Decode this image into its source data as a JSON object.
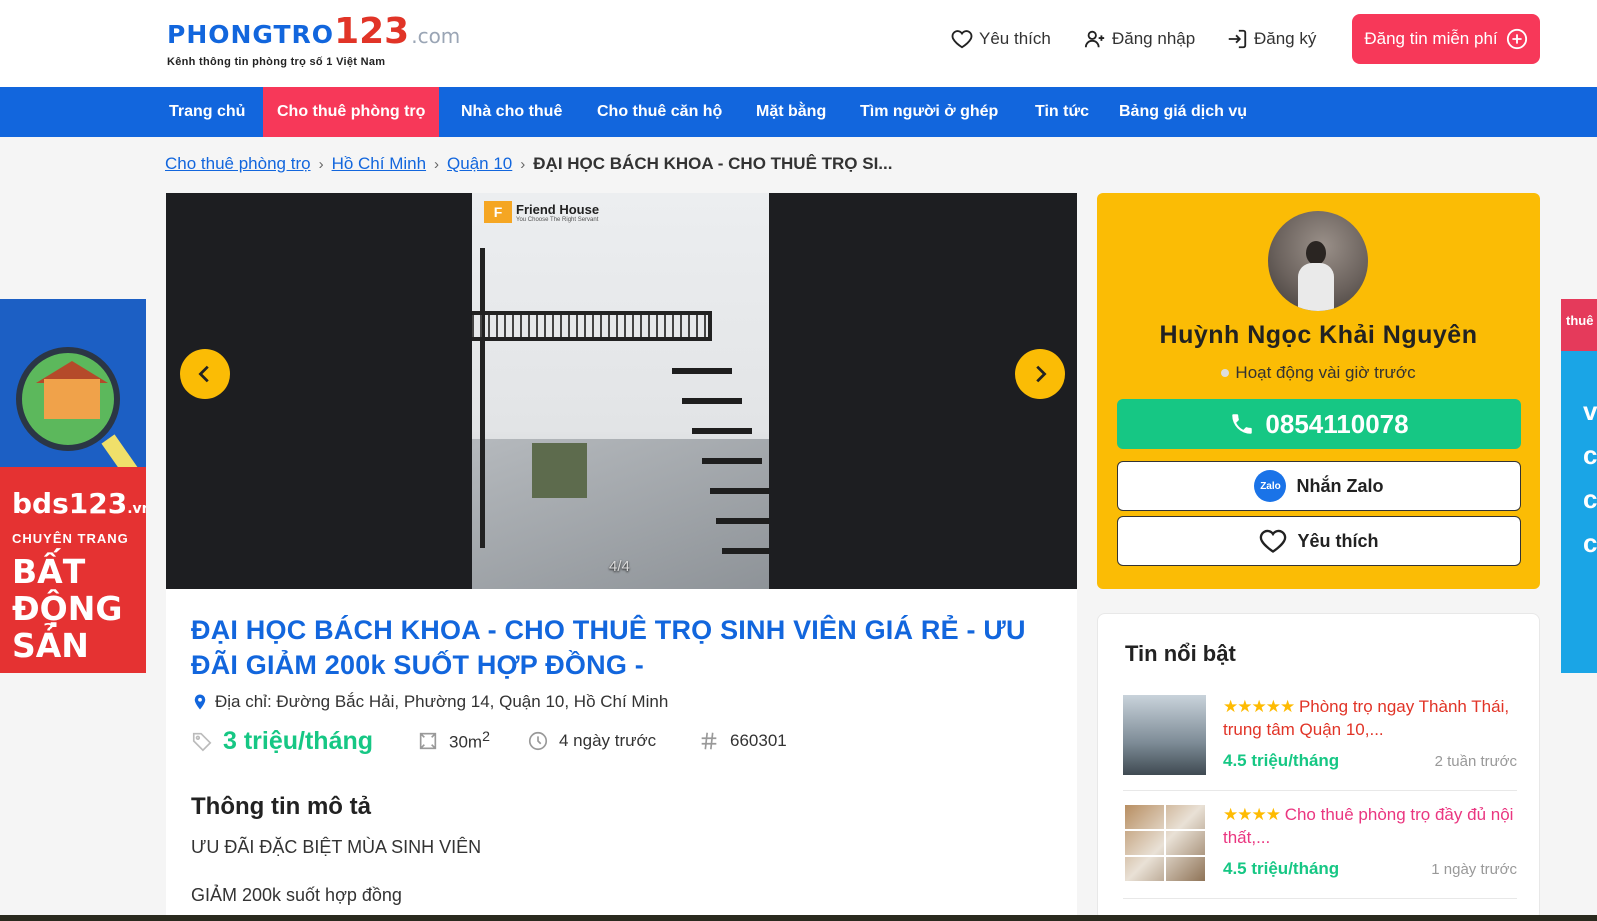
{
  "header": {
    "logo_main": "PHONGTRO",
    "logo_num": "123",
    "logo_domain": ".com",
    "logo_tagline": "Kênh thông tin phòng trọ số 1 Việt Nam",
    "favorite": "Yêu thích",
    "login": "Đăng nhập",
    "register": "Đăng ký",
    "post_free": "Đăng tin miễn phí"
  },
  "nav": [
    "Trang chủ",
    "Cho thuê phòng trọ",
    "Nhà cho thuê",
    "Cho thuê căn hộ",
    "Mặt bằng",
    "Tìm người ở ghép",
    "Tin tức",
    "Bảng giá dịch vụ"
  ],
  "breadcrumb": {
    "items": [
      "Cho thuê phòng trọ",
      "Hồ Chí Minh",
      "Quận 10"
    ],
    "current": "ĐẠI HỌC BÁCH KHOA - CHO THUÊ TRỌ SI..."
  },
  "ads": {
    "left_brand": "bds123",
    "left_brand_domain": ".vn",
    "left_sub": "CHUYÊN TRANG",
    "left_big": [
      "BẤT",
      "ĐỘNG",
      "SẢN"
    ],
    "right_top": "thuê",
    "right_chars": [
      "v",
      "c",
      "c",
      "c"
    ]
  },
  "gallery": {
    "counter": "4/4",
    "watermark": "Friend House",
    "watermark_sub": "You Choose The Right Servant",
    "watermark_letter": "F"
  },
  "post": {
    "title": "ĐẠI HỌC BÁCH KHOA - CHO THUÊ TRỌ SINH VIÊN GIÁ RẺ - ƯU ĐÃI GIẢM 200k SUỐT HỢP ĐỒNG -",
    "address": "Địa chỉ: Đường Bắc Hải, Phường 14, Quận 10, Hồ Chí Minh",
    "price": "3 triệu/tháng",
    "area": "30m",
    "area_sup": "2",
    "posted": "4 ngày trước",
    "id": "660301",
    "section_title": "Thông tin mô tả",
    "desc_lines": [
      "ƯU ĐÃI ĐẶC BIỆT MÙA SINH VIÊN",
      "GIẢM 200k suốt hợp đồng"
    ]
  },
  "contact": {
    "name": "Huỳnh Ngọc Khải Nguyên",
    "status": "Hoạt động vài giờ trước",
    "phone": "0854110078",
    "zalo_icon": "Zalo",
    "zalo_label": "Nhắn Zalo",
    "favorite": "Yêu thích"
  },
  "featured": {
    "title": "Tin nổi bật",
    "items": [
      {
        "stars": "★★★★★",
        "title": "Phòng trọ ngay Thành Thái, trung tâm Quận 10,...",
        "price": "4.5 triệu/tháng",
        "time": "2 tuần trước",
        "color": "#e13427"
      },
      {
        "stars": "★★★★",
        "title": "Cho thuê phòng trọ đầy đủ nội thất,...",
        "price": "4.5 triệu/tháng",
        "time": "1 ngày trước",
        "color": "#ea3680"
      }
    ]
  },
  "colors": {
    "brand_blue": "#1266dd",
    "accent_red": "#f73859",
    "price_green": "#16c784",
    "contact_yellow": "#fbbc05"
  }
}
